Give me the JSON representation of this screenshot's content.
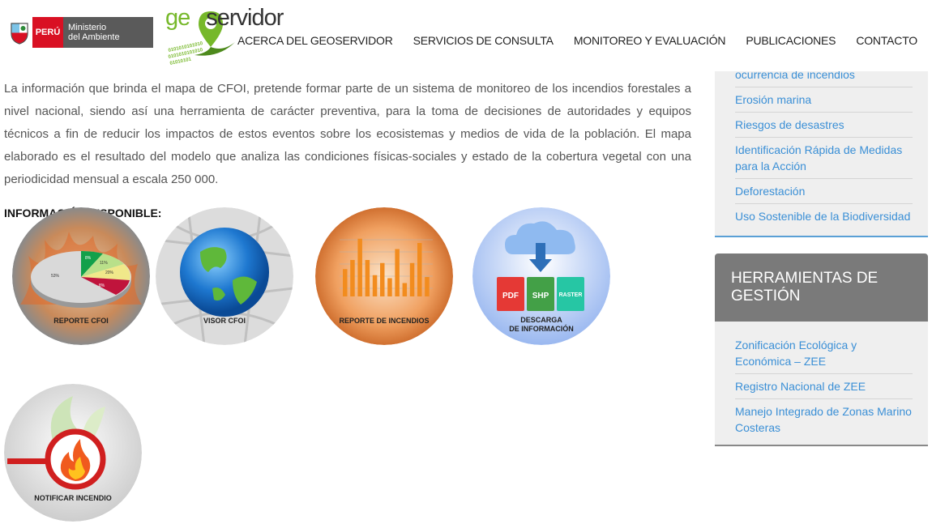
{
  "header": {
    "peru_label": "PERÚ",
    "ministry_line1": "Ministerio",
    "ministry_line2": "del Ambiente",
    "geo_prefix": "ge",
    "geo_suffix": "servidor"
  },
  "nav": {
    "items": [
      {
        "label": "ACERCA DEL GEOSERVIDOR"
      },
      {
        "label": "SERVICIOS DE CONSULTA"
      },
      {
        "label": "MONITOREO Y EVALUACIÓN"
      },
      {
        "label": "PUBLICACIONES"
      },
      {
        "label": "CONTACTO"
      }
    ]
  },
  "main": {
    "intro": "La información que brinda el mapa de CFOI, pretende formar parte de un sistema de monitoreo de los incendios forestales a nivel nacional, siendo  así una herramienta  de carácter preventiva, para la toma de decisiones  de autoridades y equipos técnicos a fin de reducir  los impactos  de estos eventos sobre los ecosistemas y medios de vida de la población. El mapa elaborado es el resultado del modelo que analiza las condiciones  físicas-sociales  y estado de la cobertura vegetal con una periodicidad mensual a escala 250 000.",
    "section_title": "INFORMACIÓN DISPONIBLE:",
    "tiles": [
      {
        "label": "REPORTE CFOI",
        "pie_labels": [
          "8%",
          "11%",
          "20%",
          "8%",
          "53%"
        ]
      },
      {
        "label": "VISOR CFOI"
      },
      {
        "label": "REPORTE DE INCENDIOS",
        "bar_values": [
          0.45,
          0.6,
          0.95,
          0.6,
          0.35,
          0.55,
          0.3,
          0.78,
          0.22,
          0.55,
          0.88,
          0.32
        ]
      },
      {
        "label_line1": "DESCARGA",
        "label_line2": "DE INFORMACIÓN",
        "formats": [
          "PDF",
          "SHP",
          "RASTER"
        ]
      },
      {
        "label": "NOTIFICAR INCENDIO"
      }
    ]
  },
  "sidebar": {
    "top_items": [
      {
        "label": "ocurrencia de incendios"
      },
      {
        "label": "Erosión marina"
      },
      {
        "label": "Riesgos de desastres"
      },
      {
        "label": "Identificación Rápida de Medidas para la Acción"
      },
      {
        "label": "Deforestación"
      },
      {
        "label": "Uso Sostenible de la Biodiversidad"
      }
    ],
    "tools_title": "HERRAMIENTAS DE GESTIÓN",
    "tools_items": [
      {
        "label": "Zonificación Ecológica y Económica – ZEE"
      },
      {
        "label": "Registro Nacional de ZEE"
      },
      {
        "label": "Manejo Integrado de Zonas Marino Costeras"
      }
    ]
  },
  "colors": {
    "link": "#3a8fd6",
    "peru_red": "#d91023",
    "geo_green": "#76b82a",
    "tools_header": "#7a7a7a"
  }
}
